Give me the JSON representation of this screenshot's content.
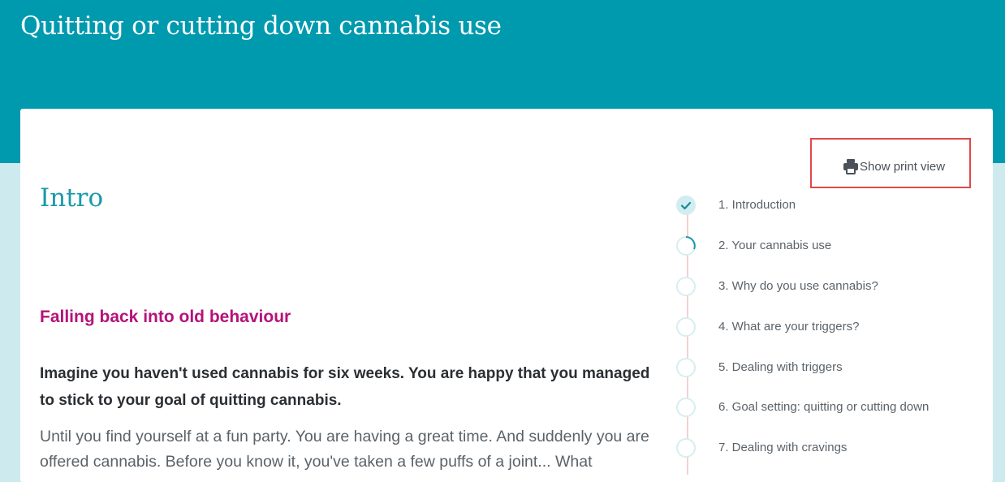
{
  "header": {
    "title": "Quitting or cutting down cannabis use"
  },
  "toolbar": {
    "print_label": "Show print view",
    "print_icon": "printer-icon",
    "highlight_color": "#e04848"
  },
  "content": {
    "heading": "Intro",
    "section_title": "Falling back into old behaviour",
    "lead": "Imagine you haven't used cannabis for six weeks. You are happy that you managed to stick to your goal of quitting cannabis.",
    "body": "Until you find yourself at a fun party. You are having a great time. And suddenly you are offered cannabis. Before you know it, you've taken a few puffs of a joint...  What"
  },
  "steps": [
    {
      "label": "1. Introduction",
      "status": "completed",
      "icon": "check-icon"
    },
    {
      "label": "2. Your cannabis use",
      "status": "in-progress",
      "icon": "progress-ring-icon"
    },
    {
      "label": "3. Why do you use cannabis?",
      "status": "not-started"
    },
    {
      "label": "4. What are your triggers?",
      "status": "not-started"
    },
    {
      "label": "5. Dealing with triggers",
      "status": "not-started"
    },
    {
      "label": "6. Goal setting: quitting or cutting down",
      "status": "not-started"
    },
    {
      "label": "7. Dealing with cravings",
      "status": "not-started"
    }
  ],
  "colors": {
    "header_bg": "#009aaf",
    "page_bg": "#cdebee",
    "heading": "#1a9aaa",
    "section_title": "#b5127a",
    "step_accent": "#1a9aaa"
  }
}
